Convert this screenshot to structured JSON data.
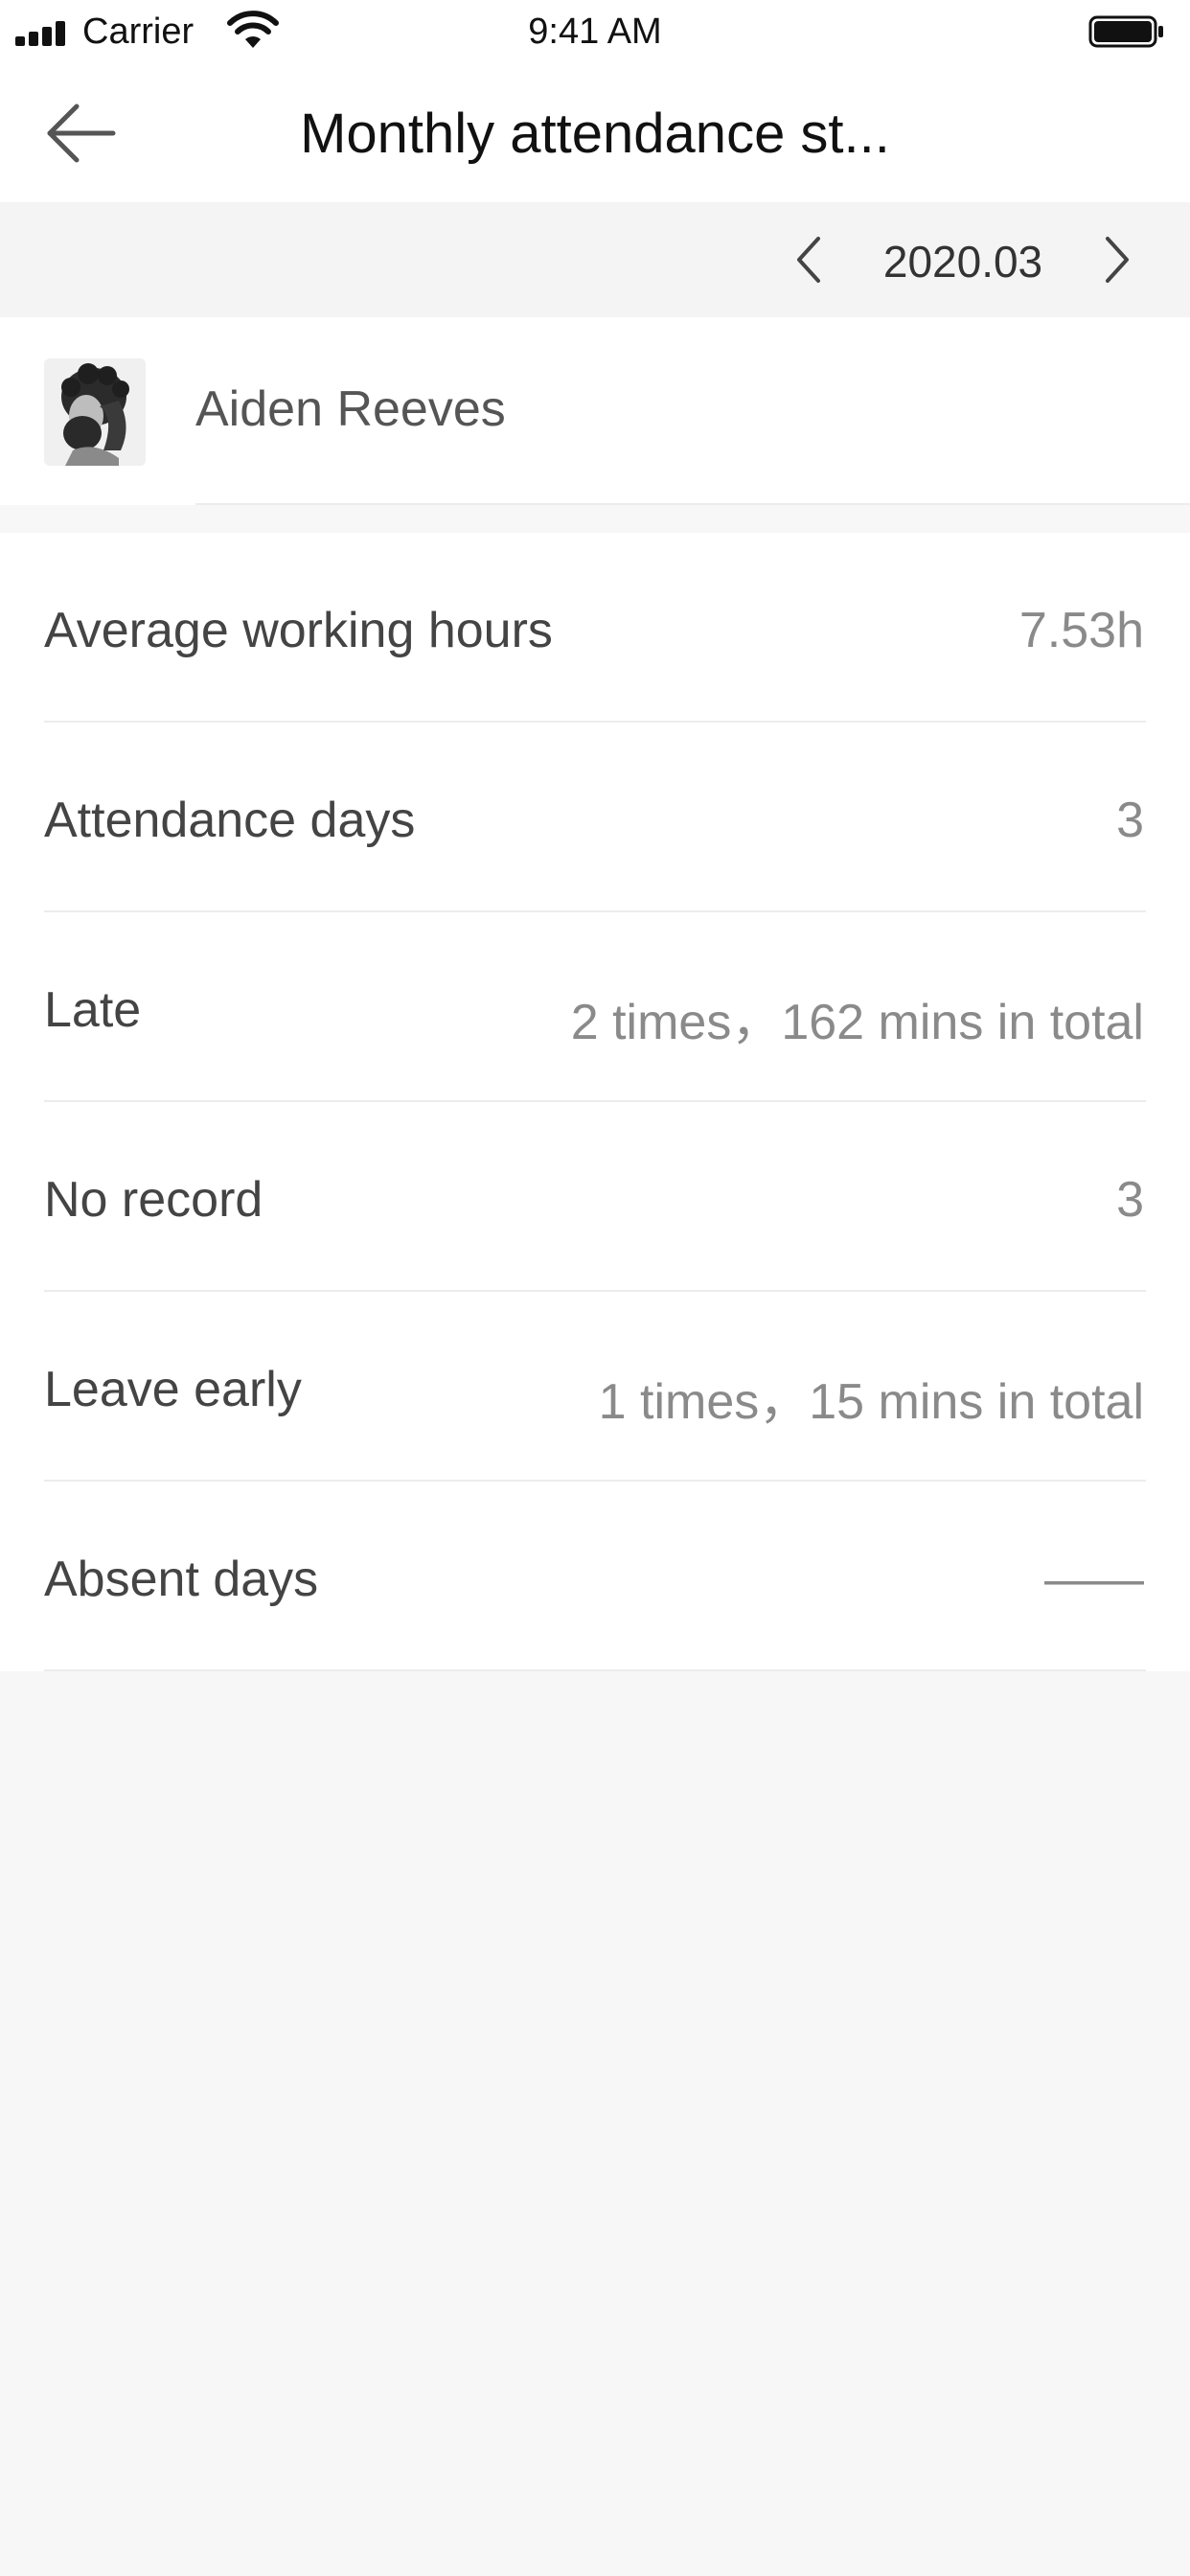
{
  "status_bar": {
    "carrier": "Carrier",
    "time": "9:41 AM",
    "icons": [
      "signal-icon",
      "wifi-icon",
      "battery-icon"
    ]
  },
  "nav": {
    "title": "Monthly attendance st...",
    "back_icon": "arrow-left-icon"
  },
  "month_selector": {
    "value": "2020.03",
    "prev_icon": "chevron-left-icon",
    "next_icon": "chevron-right-icon"
  },
  "user": {
    "name": "Aiden Reeves",
    "avatar_icon": "user-avatar"
  },
  "stats": [
    {
      "label": "Average working hours",
      "value": "7.53h"
    },
    {
      "label": "Attendance days",
      "value": "3"
    },
    {
      "label": "Late",
      "value": "2 times，162 mins in total"
    },
    {
      "label": "No record",
      "value": "3"
    },
    {
      "label": "Leave early",
      "value": "1 times，15 mins in total"
    },
    {
      "label": "Absent days",
      "value": "——"
    }
  ],
  "colors": {
    "background": "#f7f7f7",
    "surface": "#ffffff",
    "label_text": "#444444",
    "value_text": "#8a8a8a",
    "divider": "#ececec"
  }
}
